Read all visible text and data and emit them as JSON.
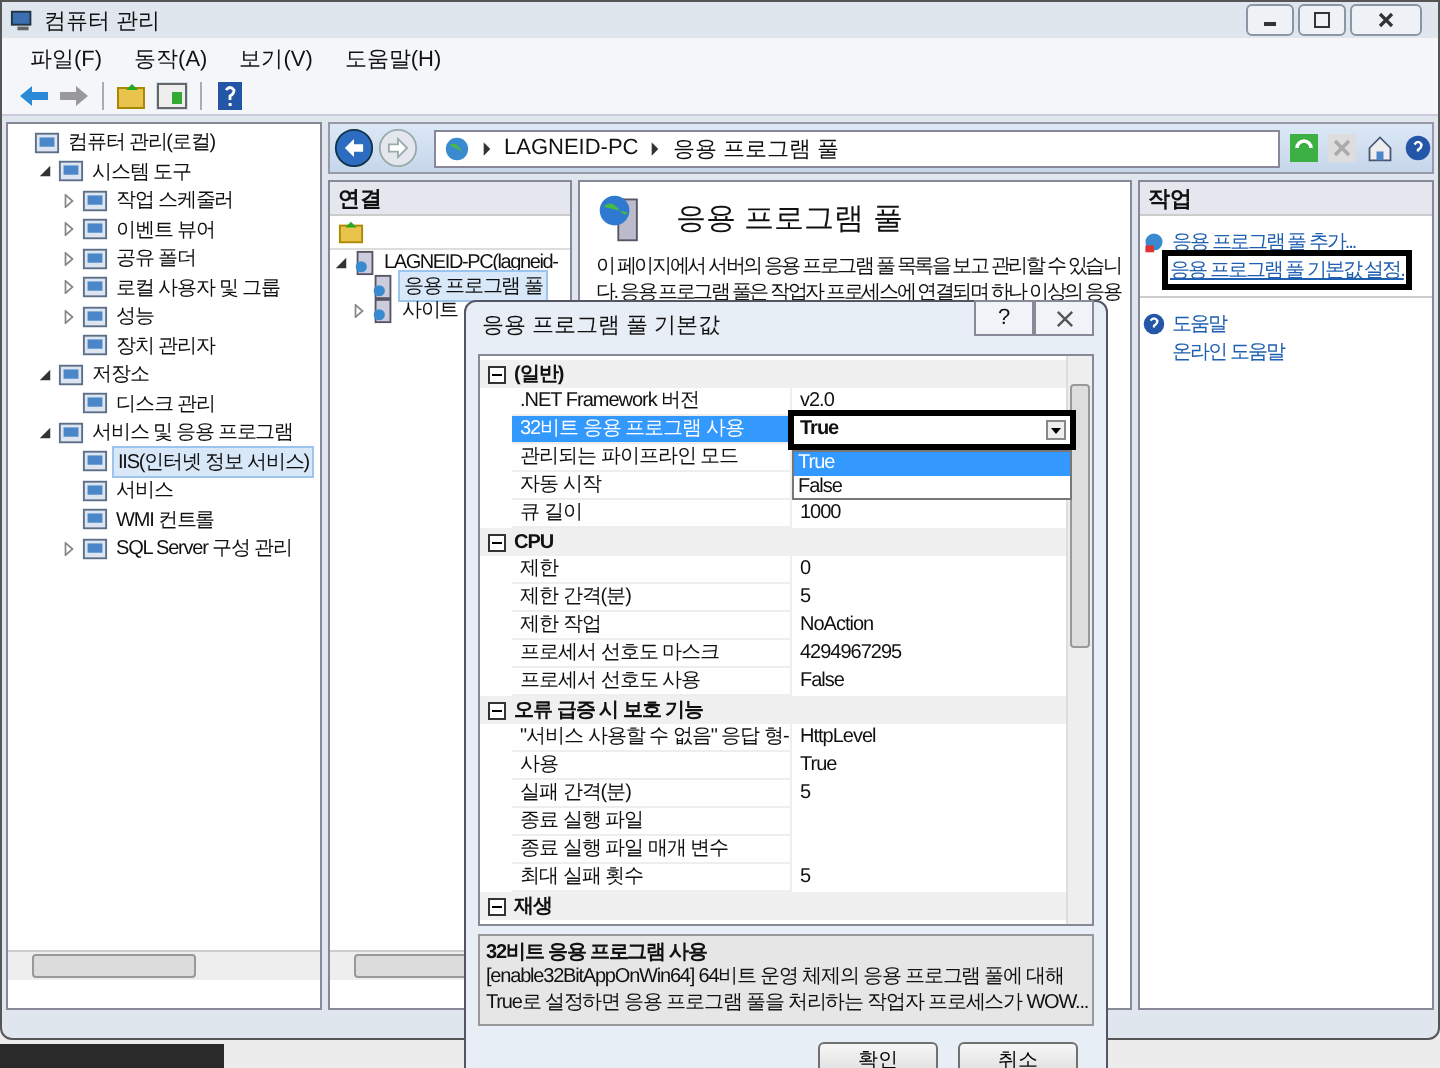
{
  "window": {
    "title": "컴퓨터 관리"
  },
  "menu": [
    "파일(F)",
    "동작(A)",
    "보기(V)",
    "도움말(H)"
  ],
  "tree": [
    {
      "label": "컴퓨터 관리(로컬)",
      "selected": false,
      "children": [
        {
          "label": "시스템 도구",
          "expanded": true,
          "selected": false,
          "children": [
            {
              "label": "작업 스케줄러",
              "expanded": false,
              "selected": false
            },
            {
              "label": "이벤트 뷰어",
              "expanded": false,
              "selected": false
            },
            {
              "label": "공유 폴더",
              "expanded": false,
              "selected": false
            },
            {
              "label": "로컬 사용자 및 그룹",
              "expanded": false,
              "selected": false
            },
            {
              "label": "성능",
              "expanded": false,
              "selected": false
            },
            {
              "label": "장치 관리자",
              "selected": false
            }
          ]
        },
        {
          "label": "저장소",
          "expanded": true,
          "selected": false,
          "children": [
            {
              "label": "디스크 관리",
              "selected": false
            }
          ]
        },
        {
          "label": "서비스 및 응용 프로그램",
          "expanded": true,
          "selected": false,
          "children": [
            {
              "label": "IIS(인터넷 정보 서비스)",
              "selected": true
            },
            {
              "label": "서비스",
              "selected": false
            },
            {
              "label": "WMI 컨트롤",
              "selected": false
            },
            {
              "label": "SQL Server 구성 관리",
              "expanded": false,
              "selected": false
            }
          ]
        }
      ]
    }
  ],
  "breadcrumb": [
    "LAGNEID-PC",
    "응용 프로그램 풀"
  ],
  "connections": {
    "title": "연결",
    "tree": [
      {
        "label": "LAGNEID-PC(lagneid-",
        "expanded": true,
        "selected": false,
        "children": [
          {
            "label": "응용 프로그램 풀",
            "selected": true
          },
          {
            "label": "사이트",
            "expanded": false,
            "selected": false
          }
        ]
      }
    ]
  },
  "center": {
    "heading": "응용 프로그램 풀",
    "description_lines": [
      "이 페이지에서 서버의 응용 프로그램 풀 목록을 보고 관리할 수 있습니",
      "다. 응용 프로그램 풀은 작업자 프로세스에 연결되며 하나 이상의 응용"
    ]
  },
  "actions": {
    "title": "작업",
    "groups": [
      [
        {
          "label": "응용 프로그램 풀 추가...",
          "highlighted": false
        },
        {
          "label": "응용 프로그램 풀 기본값 설정.",
          "highlighted": true
        }
      ],
      [
        {
          "label": "도움말",
          "highlighted": false
        },
        {
          "label": "온라인 도움말",
          "highlighted": false
        }
      ]
    ]
  },
  "dialog": {
    "title": "응용 프로그램 풀 기본값",
    "help": "?",
    "categories": [
      {
        "name": "(일반)",
        "expanded": true,
        "rows": [
          {
            "name": ".NET Framework 버전",
            "value": "v2.0",
            "selected": false
          },
          {
            "name": "32비트 응용 프로그램 사용",
            "selected": true,
            "dropdown": {
              "value": "True",
              "options": [
                {
                  "label": "True",
                  "selected": true
                },
                {
                  "label": "False",
                  "selected": false
                }
              ]
            }
          },
          {
            "name": "관리되는 파이프라인 모드",
            "selected": false
          },
          {
            "name": "자동 시작",
            "selected": false
          },
          {
            "name": "큐 길이",
            "value": "1000",
            "selected": false
          }
        ]
      },
      {
        "name": "CPU",
        "expanded": true,
        "rows": [
          {
            "name": "제한",
            "value": "0",
            "selected": false
          },
          {
            "name": "제한 간격(분)",
            "value": "5",
            "selected": false
          },
          {
            "name": "제한 작업",
            "value": "NoAction",
            "selected": false
          },
          {
            "name": "프로세서 선호도 마스크",
            "value": "4294967295",
            "selected": false
          },
          {
            "name": "프로세서 선호도 사용",
            "value": "False",
            "selected": false
          }
        ]
      },
      {
        "name": "오류 급증 시 보호 기능",
        "expanded": true,
        "rows": [
          {
            "name": "\"서비스 사용할 수 없음\" 응답 형-",
            "value": "HttpLevel",
            "selected": false
          },
          {
            "name": "사용",
            "value": "True",
            "selected": false
          },
          {
            "name": "실패 간격(분)",
            "value": "5",
            "selected": false
          },
          {
            "name": "종료 실행 파일",
            "selected": false
          },
          {
            "name": "종료 실행 파일 매개 변수",
            "selected": false
          },
          {
            "name": "최대 실패 횟수",
            "value": "5",
            "selected": false
          }
        ]
      },
      {
        "name": "재생",
        "expanded": true
      }
    ],
    "description_title": "32비트 응용 프로그램 사용",
    "description_lines": [
      "[enable32BitAppOnWin64] 64비트 운영 체제의 응용 프로그램 풀에 대해",
      "True로 설정하면 응용 프로그램 풀을 처리하는 작업자 프로세스가 WOW..."
    ],
    "buttons": [
      "확인",
      "취소"
    ]
  }
}
